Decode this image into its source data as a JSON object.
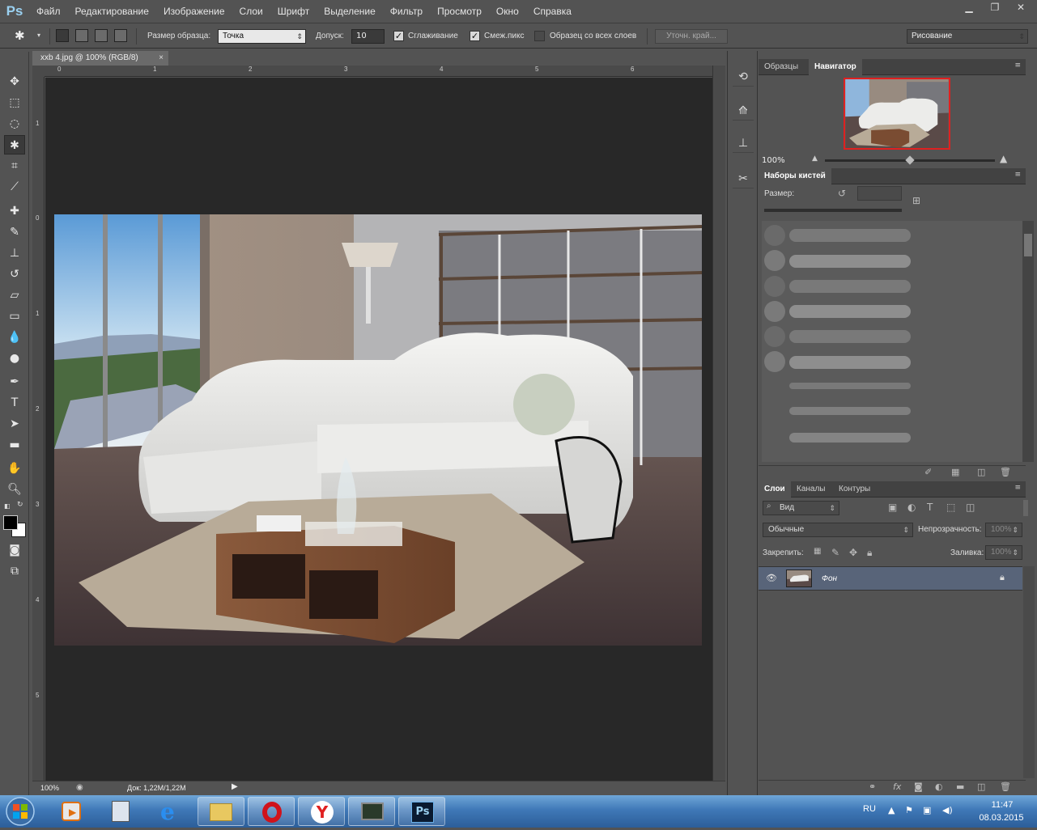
{
  "app": {
    "logo": "Ps"
  },
  "menu": [
    "Файл",
    "Редактирование",
    "Изображение",
    "Слои",
    "Шрифт",
    "Выделение",
    "Фильтр",
    "Просмотр",
    "Окно",
    "Справка"
  ],
  "options": {
    "sample_size_label": "Размер образца:",
    "sample_size_value": "Точка",
    "tolerance_label": "Допуск:",
    "tolerance_value": "10",
    "antialias_label": "Сглаживание",
    "contiguous_label": "Смеж.пикс",
    "all_layers_label": "Образец со всех слоев",
    "refine_edge_label": "Уточн. край...",
    "workspace_value": "Рисование"
  },
  "document": {
    "tab_title": "xxb 4.jpg @ 100% (RGB/8)",
    "tab_close": "×",
    "ruler_top": [
      "0",
      "1",
      "2",
      "3",
      "4",
      "5",
      "6"
    ],
    "ruler_left": [
      "1",
      "0",
      "1",
      "2",
      "3",
      "4",
      "5"
    ],
    "status_zoom": "100%",
    "status_doc": "Док: 1,22M/1,22M"
  },
  "navigator": {
    "tabs": [
      "Образцы",
      "Навигатор"
    ],
    "zoom": "100%"
  },
  "brushes": {
    "tabs": [
      "Наборы кистей"
    ],
    "size_label": "Размер:"
  },
  "layers": {
    "tabs": [
      "Слои",
      "Каналы",
      "Контуры"
    ],
    "filter_kind": "Вид",
    "blend_mode": "Обычные",
    "opacity_label": "Непрозрачность:",
    "opacity_value": "100%",
    "lock_label": "Закрепить:",
    "fill_label": "Заливка:",
    "fill_value": "100%",
    "layer_name": "Фон"
  },
  "taskbar": {
    "lang": "RU",
    "time": "11:47",
    "date": "08.03.2015"
  },
  "colors": {
    "accent": "#e02020",
    "panel": "#535353",
    "canvas_bg": "#282828",
    "layer_selected": "#586479"
  }
}
